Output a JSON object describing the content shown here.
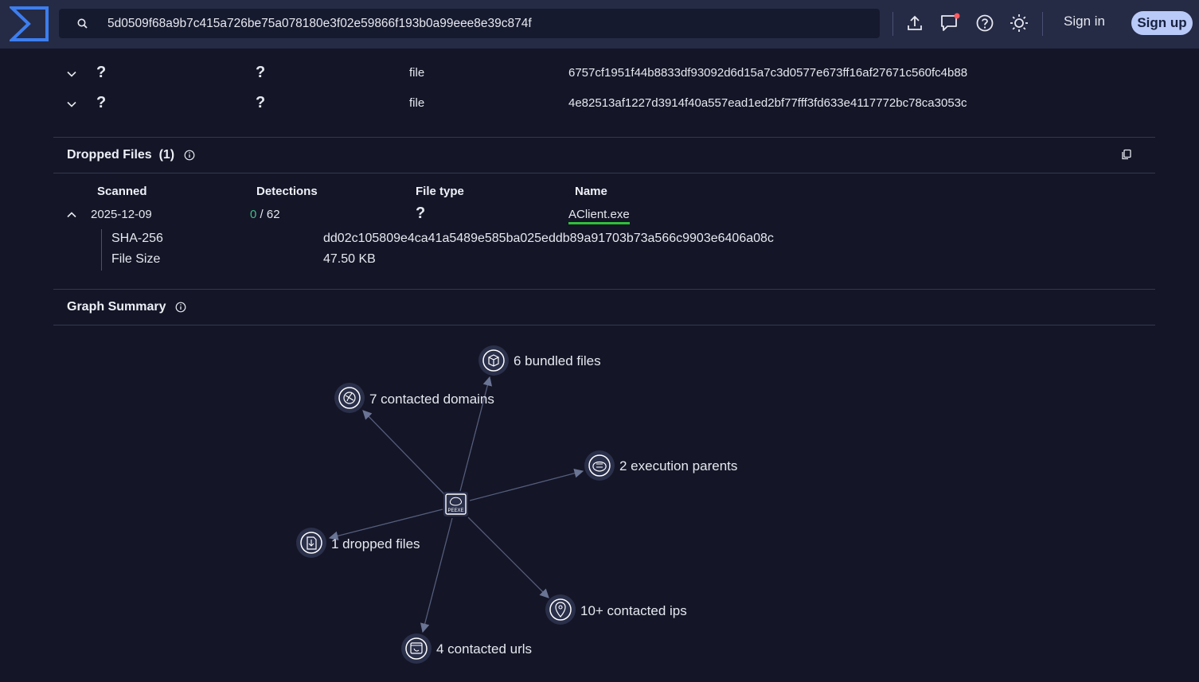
{
  "search": {
    "value": "5d0509f68a9b7c415a726be75a078180e3f02e59866f193b0a99eee8e39c874f"
  },
  "header": {
    "signin_label": "Sign in",
    "signup_label": "Sign up"
  },
  "bundled_rows": [
    {
      "col1": "?",
      "col2": "?",
      "type": "file",
      "hash": "6757cf1951f44b8833df93092d6d15a7c3d0577e673ff16af27671c560fc4b88"
    },
    {
      "col1": "?",
      "col2": "?",
      "type": "file",
      "hash": "4e82513af1227d3914f40a557ead1ed2bf77fff3fd633e4117772bc78ca3053c"
    }
  ],
  "dropped_files": {
    "title": "Dropped Files",
    "count": "(1)",
    "headers": {
      "scanned": "Scanned",
      "detections": "Detections",
      "file_type": "File type",
      "name": "Name"
    },
    "row": {
      "scanned": "2025-12-09",
      "detections_positive": "0",
      "detections_total": "/ 62",
      "file_type": "?",
      "name": "AClient.exe"
    },
    "details": {
      "sha_label": "SHA-256",
      "sha_value": "dd02c105809e4ca41a5489e585ba025eddb89a91703b73a566c9903e6406a08c",
      "size_label": "File Size",
      "size_value": "47.50 KB"
    }
  },
  "graph_summary": {
    "title": "Graph Summary",
    "center_label": "PEEXE",
    "nodes": [
      {
        "label": "6 bundled files"
      },
      {
        "label": "7 contacted domains"
      },
      {
        "label": "2 execution parents"
      },
      {
        "label": "1 dropped files"
      },
      {
        "label": "10+ contacted ips"
      },
      {
        "label": "4 contacted urls"
      }
    ]
  }
}
